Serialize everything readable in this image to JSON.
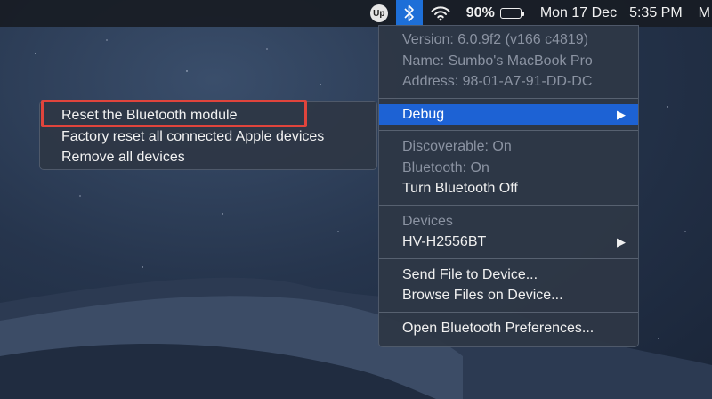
{
  "menubar": {
    "app_icon_text": "Up",
    "battery_percent": "90%",
    "battery_level": 0.9,
    "date": "Mon 17 Dec",
    "time": "5:35 PM",
    "trailing_letter": "M",
    "icons": [
      "up-app-icon",
      "bluetooth-icon",
      "wifi-icon",
      "battery-icon"
    ]
  },
  "bluetooth_menu": {
    "version": "Version: 6.0.9f2 (v166 c4819)",
    "name": "Name: Sumbo's MacBook Pro",
    "address": "Address: 98-01-A7-91-DD-DC",
    "debug": "Debug",
    "discoverable": "Discoverable: On",
    "bluetooth_status": "Bluetooth: On",
    "turn_off": "Turn Bluetooth Off",
    "devices_header": "Devices",
    "device_1": "HV-H2556BT",
    "send_file": "Send File to Device...",
    "browse_files": "Browse Files on Device...",
    "open_prefs": "Open Bluetooth Preferences..."
  },
  "debug_submenu": {
    "reset_module": "Reset the Bluetooth module",
    "factory_reset": "Factory reset all connected Apple devices",
    "remove_all": "Remove all devices"
  },
  "colors": {
    "accent": "#1d62d4",
    "callout": "#e0443c"
  }
}
